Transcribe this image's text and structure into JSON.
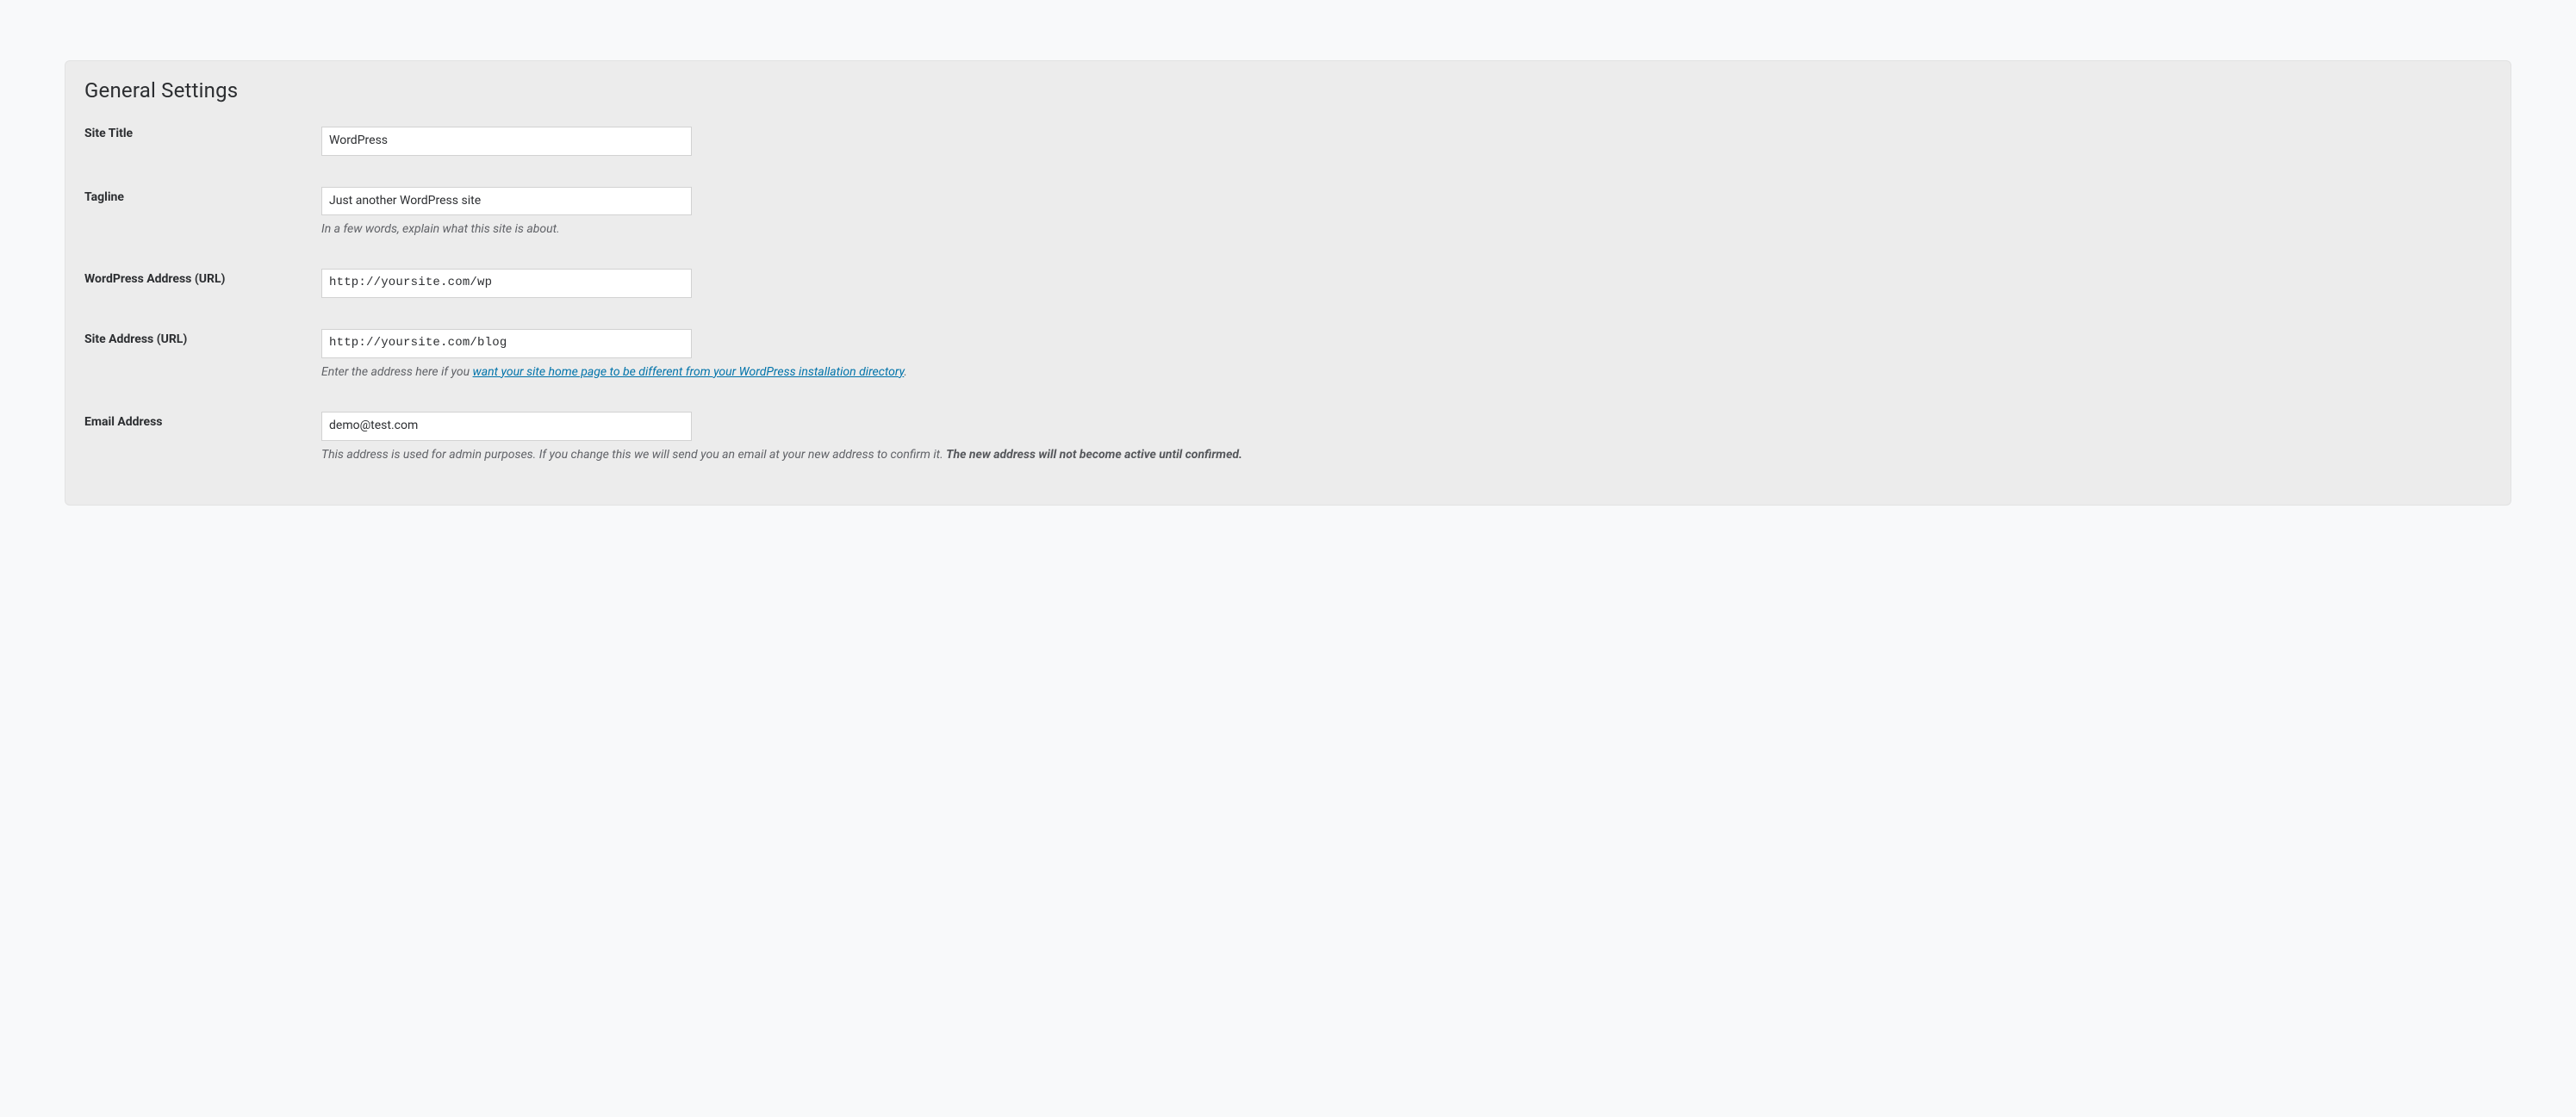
{
  "page": {
    "title": "General Settings"
  },
  "fields": {
    "site_title": {
      "label": "Site Title",
      "value": "WordPress"
    },
    "tagline": {
      "label": "Tagline",
      "value": "Just another WordPress site",
      "desc": "In a few words, explain what this site is about."
    },
    "wp_url": {
      "label": "WordPress Address (URL)",
      "value": "http://yoursite.com/wp"
    },
    "site_url": {
      "label": "Site Address (URL)",
      "value": "http://yoursite.com/blog",
      "desc_prefix": "Enter the address here if you ",
      "desc_link": "want your site home page to be different from your WordPress installation directory",
      "desc_suffix": "."
    },
    "email": {
      "label": "Email Address",
      "value": "demo@test.com",
      "desc_plain": "This address is used for admin purposes. If you change this we will send you an email at your new address to confirm it. ",
      "desc_strong": "The new address will not become active until confirmed."
    }
  }
}
